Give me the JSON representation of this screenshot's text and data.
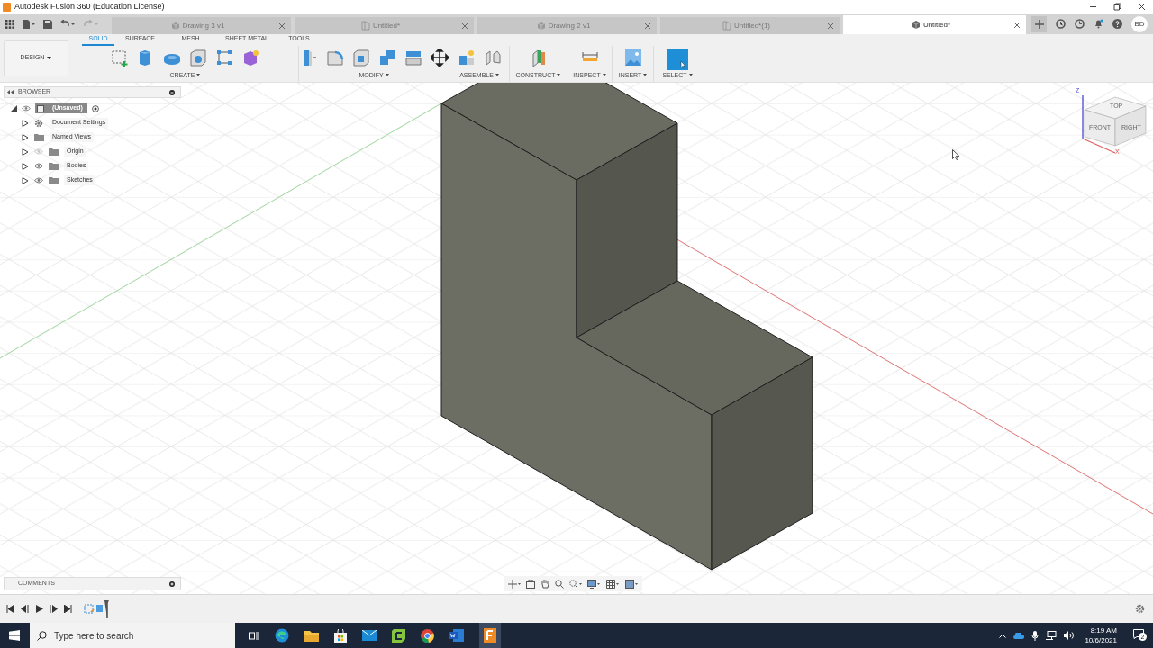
{
  "window": {
    "title": "Autodesk Fusion 360 (Education License)"
  },
  "document_tabs": [
    {
      "label": "Drawing 3 v1",
      "kind": "drawing",
      "selected": false
    },
    {
      "label": "Untitled*",
      "kind": "sketch",
      "selected": false
    },
    {
      "label": "Drawing 2 v1",
      "kind": "drawing",
      "selected": false
    },
    {
      "label": "Untitled*(1)",
      "kind": "sketch",
      "selected": false
    },
    {
      "label": "Untitled*",
      "kind": "drawing",
      "selected": true
    }
  ],
  "user_initials": "BD",
  "workspace": "DESIGN",
  "toolbar_tabs": [
    {
      "label": "SOLID",
      "selected": true
    },
    {
      "label": "SURFACE",
      "selected": false
    },
    {
      "label": "MESH",
      "selected": false
    },
    {
      "label": "SHEET METAL",
      "selected": false
    },
    {
      "label": "TOOLS",
      "selected": false
    }
  ],
  "tool_groups": [
    {
      "label": "CREATE"
    },
    {
      "label": "MODIFY"
    },
    {
      "label": "ASSEMBLE"
    },
    {
      "label": "CONSTRUCT"
    },
    {
      "label": "INSPECT"
    },
    {
      "label": "INSERT"
    },
    {
      "label": "SELECT"
    }
  ],
  "browser": {
    "title": "BROWSER",
    "root": {
      "label": "(Unsaved)",
      "expanded": true
    },
    "items": [
      {
        "label": "Document Settings",
        "kind": "settings"
      },
      {
        "label": "Named Views",
        "kind": "folder"
      },
      {
        "label": "Origin",
        "kind": "folder",
        "visible": false
      },
      {
        "label": "Bodies",
        "kind": "folder",
        "visible": true
      },
      {
        "label": "Sketches",
        "kind": "folder",
        "visible": true
      }
    ]
  },
  "view_cube": {
    "faces": [
      "TOP",
      "FRONT",
      "RIGHT"
    ],
    "axes": [
      "Z",
      "X"
    ]
  },
  "comments": {
    "title": "COMMENTS"
  },
  "taskbar": {
    "search_placeholder": "Type here to search",
    "time": "8:19 AM",
    "date": "10/6/2021",
    "notifications": "2"
  }
}
